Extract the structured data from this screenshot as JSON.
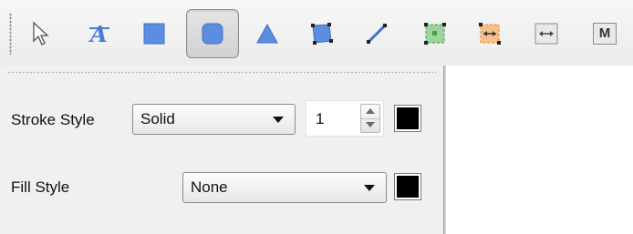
{
  "toolbar": {
    "tools": [
      {
        "name": "pointer-tool",
        "icon": "arrow-pointer-icon"
      },
      {
        "name": "text-tool",
        "icon": "text-a-icon"
      },
      {
        "name": "rectangle-tool",
        "icon": "square-icon"
      },
      {
        "name": "rounded-rectangle-tool",
        "icon": "rounded-square-icon",
        "active": true
      },
      {
        "name": "triangle-tool",
        "icon": "triangle-icon"
      },
      {
        "name": "polygon-tool",
        "icon": "polygon-points-icon"
      },
      {
        "name": "line-tool",
        "icon": "line-icon"
      },
      {
        "name": "select-points-tool",
        "icon": "dashed-select-icon"
      },
      {
        "name": "connector-tool",
        "icon": "connector-icon"
      },
      {
        "name": "arrow-width-tool",
        "icon": "double-arrow-icon"
      },
      {
        "name": "m-tool",
        "icon": "m-letter-icon",
        "text": "M"
      }
    ]
  },
  "properties": {
    "stroke_style_label": "Stroke Style",
    "stroke_style_value": "Solid",
    "stroke_width": "1",
    "stroke_color": "#000000",
    "fill_style_label": "Fill Style",
    "fill_style_value": "None",
    "fill_color": "#000000"
  },
  "colors": {
    "icon_blue": "#4a7bd0",
    "icon_green": "#3fa33f",
    "icon_orange": "#e08a2c"
  }
}
